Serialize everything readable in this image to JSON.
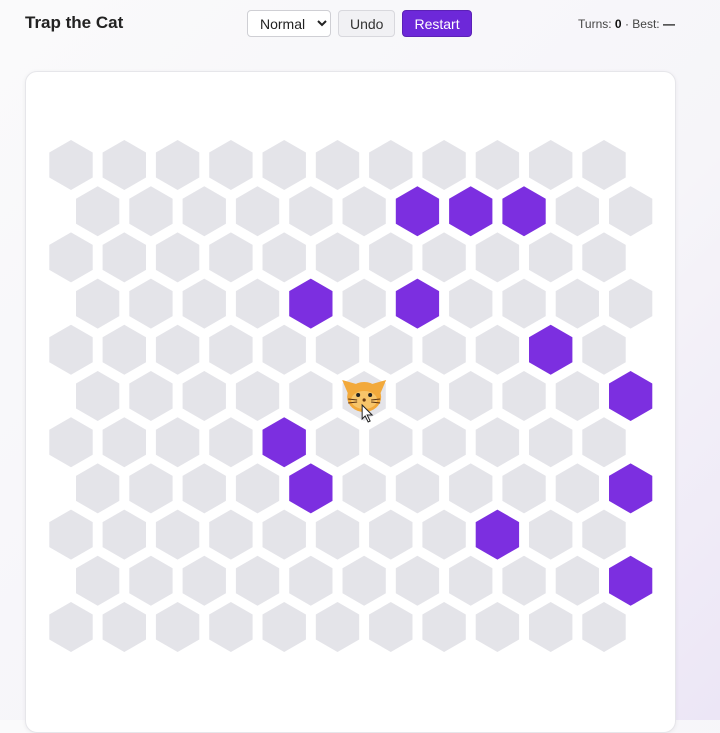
{
  "app": {
    "title": "Trap the Cat"
  },
  "controls": {
    "difficulty_selected": "Normal",
    "undo_label": "Undo",
    "restart_label": "Restart"
  },
  "stats": {
    "turns_label": "Turns:",
    "turns_value": "0",
    "separator": "·",
    "best_label": "Best:",
    "best_value": "—"
  },
  "board": {
    "rows": 11,
    "cols": 11,
    "blocked": [
      [
        1,
        6
      ],
      [
        1,
        7
      ],
      [
        1,
        8
      ],
      [
        3,
        4
      ],
      [
        3,
        6
      ],
      [
        4,
        9
      ],
      [
        5,
        10
      ],
      [
        6,
        4
      ],
      [
        7,
        4
      ],
      [
        7,
        10
      ],
      [
        8,
        8
      ],
      [
        9,
        10
      ]
    ],
    "cat": [
      5,
      5
    ],
    "colors": {
      "empty": "#e4e4e9",
      "blocked": "#7c2fe0",
      "cat": "#f2a93b"
    }
  }
}
